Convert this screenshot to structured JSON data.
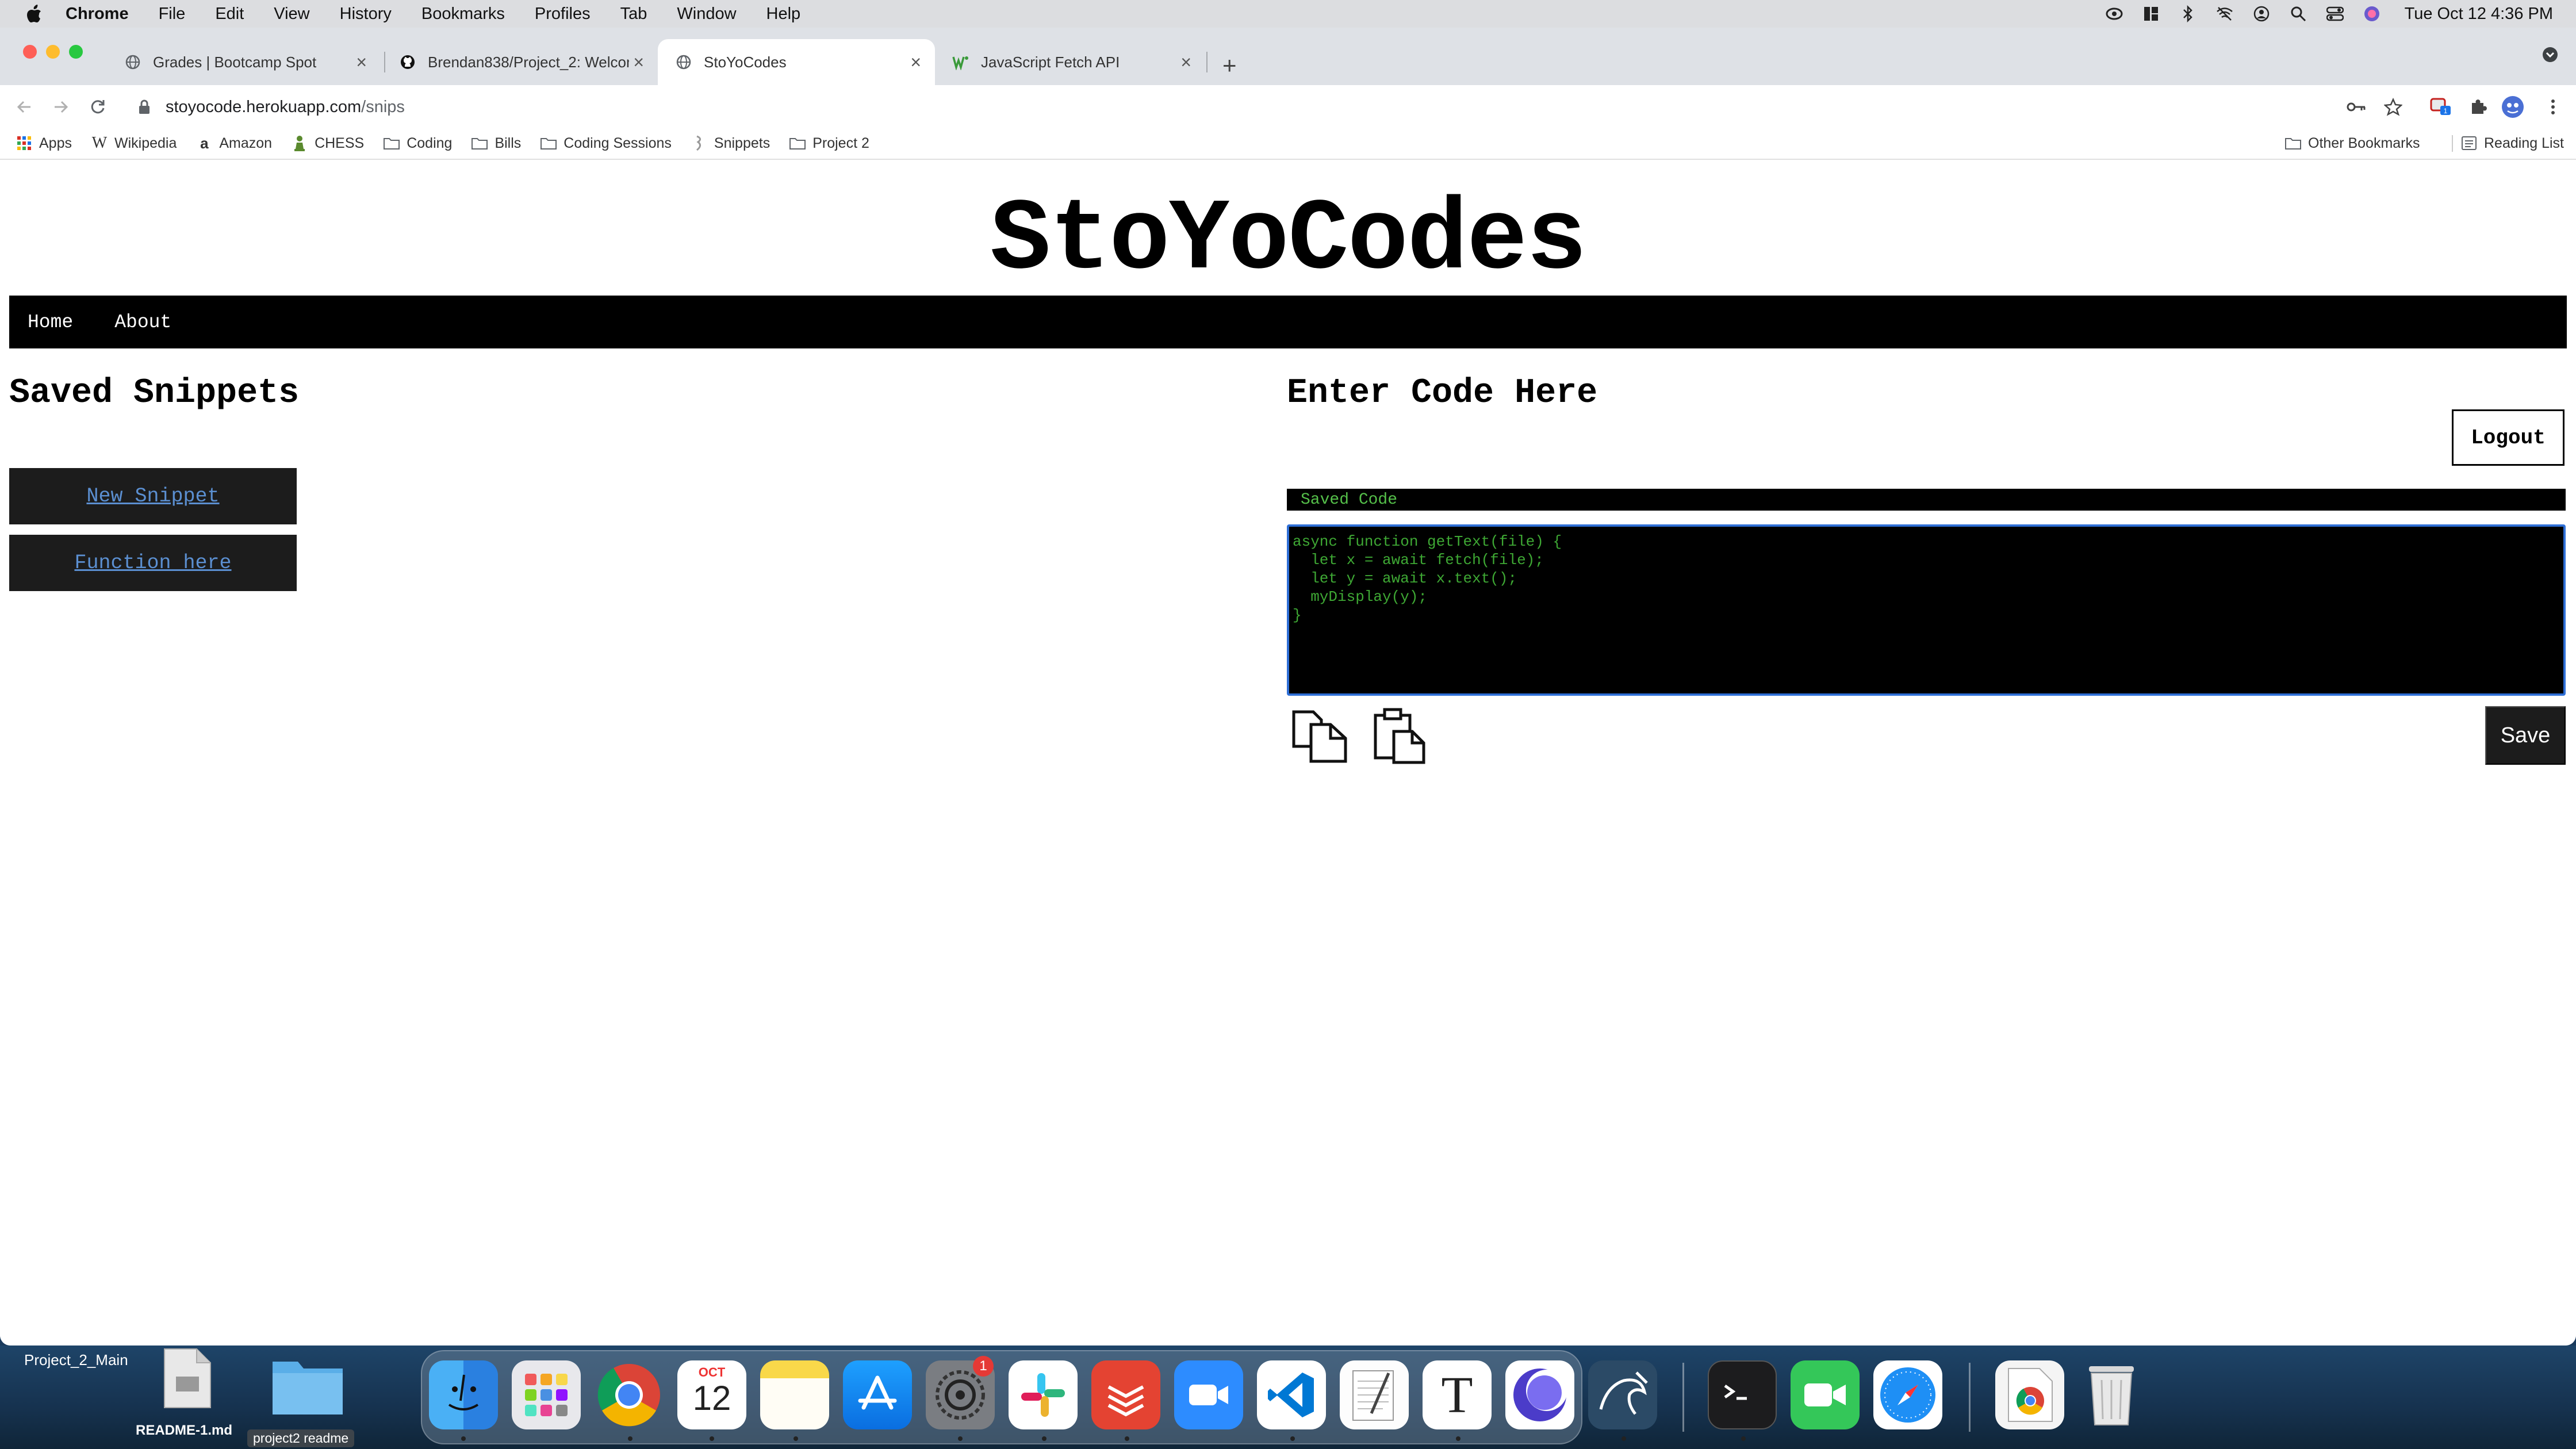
{
  "menubar": {
    "app": "Chrome",
    "items": [
      "File",
      "Edit",
      "View",
      "History",
      "Bookmarks",
      "Profiles",
      "Tab",
      "Window",
      "Help"
    ],
    "clock": "Tue Oct 12  4:36 PM"
  },
  "tabs": [
    {
      "title": "Grades | Bootcamp Spot"
    },
    {
      "title": "Brendan838/Project_2: Welcom"
    },
    {
      "title": "StoYoCodes"
    },
    {
      "title": "JavaScript Fetch API"
    }
  ],
  "address": {
    "domain": "stoyocode.herokuapp.com",
    "path": "/snips"
  },
  "bookmarks": {
    "items": [
      "Apps",
      "Wikipedia",
      "Amazon",
      "CHESS",
      "Coding",
      "Bills",
      "Coding Sessions",
      "Snippets",
      "Project 2"
    ],
    "other": "Other Bookmarks",
    "reading_list": "Reading List"
  },
  "page": {
    "title": "StoYoCodes",
    "nav": {
      "home": "Home",
      "about": "About"
    },
    "saved_heading": "Saved Snippets",
    "snippets": [
      "New Snippet",
      "Function here"
    ],
    "code_heading": "Enter Code Here",
    "logout": "Logout",
    "saved_code_label": "Saved Code",
    "code_lines": [
      "async function getText(file) {",
      "  let x = await fetch(file);",
      "  let y = await x.text();",
      "  myDisplay(y);",
      "}"
    ],
    "save": "Save"
  },
  "desktop": {
    "folder_label": "Project_2_Main",
    "file_label": "README-1.md",
    "folder2_label": "project2 readme"
  },
  "dock": {
    "calendar_month": "OCT",
    "calendar_day": "12",
    "badge": "1",
    "text_edit_glyph": "T"
  }
}
